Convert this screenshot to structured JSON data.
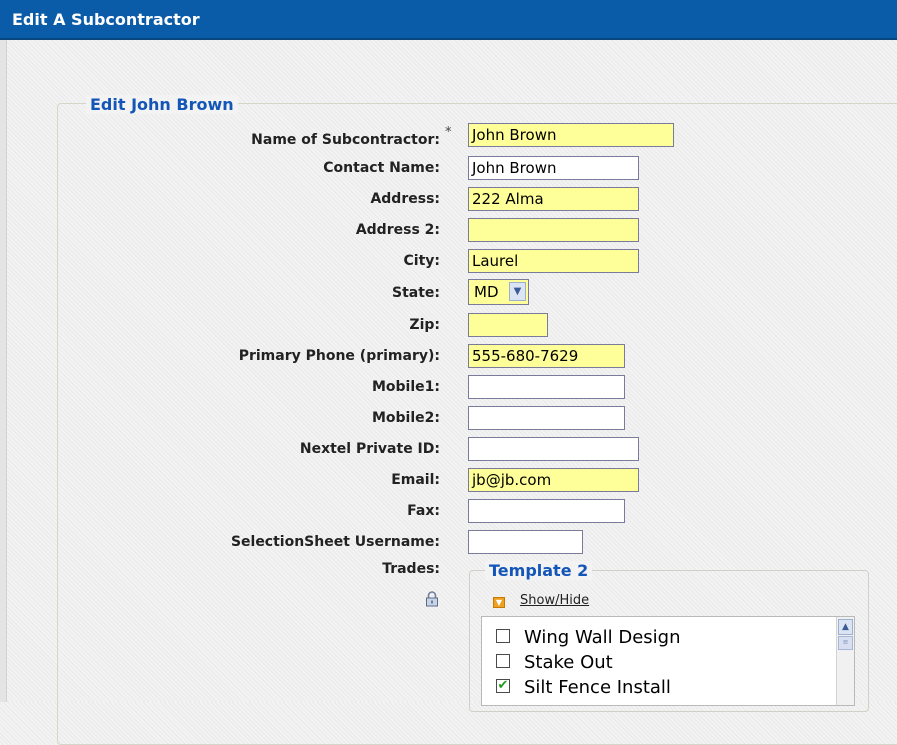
{
  "window": {
    "title": "Edit A Subcontractor"
  },
  "form": {
    "legend": "Edit John Brown",
    "required_marker": "*",
    "fields": {
      "name": {
        "label": "Name of Subcontractor:",
        "value": "John Brown"
      },
      "contact": {
        "label": "Contact Name:",
        "value": "John Brown"
      },
      "address": {
        "label": "Address:",
        "value": "222 Alma"
      },
      "address2": {
        "label": "Address 2:",
        "value": ""
      },
      "city": {
        "label": "City:",
        "value": "Laurel"
      },
      "state": {
        "label": "State:",
        "value": "MD"
      },
      "zip": {
        "label": "Zip:",
        "value": ""
      },
      "phone": {
        "label": "Primary Phone (primary):",
        "value": "555-680-7629"
      },
      "mobile1": {
        "label": "Mobile1:",
        "value": ""
      },
      "mobile2": {
        "label": "Mobile2:",
        "value": ""
      },
      "nextel": {
        "label": "Nextel Private ID:",
        "value": ""
      },
      "email": {
        "label": "Email:",
        "value": "jb@jb.com"
      },
      "fax": {
        "label": "Fax:",
        "value": ""
      },
      "selection": {
        "label": "SelectionSheet Username:",
        "value": ""
      }
    },
    "trades": {
      "label": "Trades:",
      "template_legend": "Template 2",
      "show_hide": "Show/Hide",
      "items": [
        {
          "label": "Wing Wall Design",
          "checked": false
        },
        {
          "label": "Stake Out",
          "checked": false
        },
        {
          "label": "Silt Fence Install",
          "checked": true
        }
      ]
    }
  },
  "colors": {
    "titlebar": "#0b5ca8",
    "required_field": "#ffff99",
    "legend_text": "#1456b8"
  },
  "icons": {
    "lock": "lock-icon",
    "show_hide": "collapse-arrow-icon",
    "scroll_up": "scroll-up-icon"
  }
}
